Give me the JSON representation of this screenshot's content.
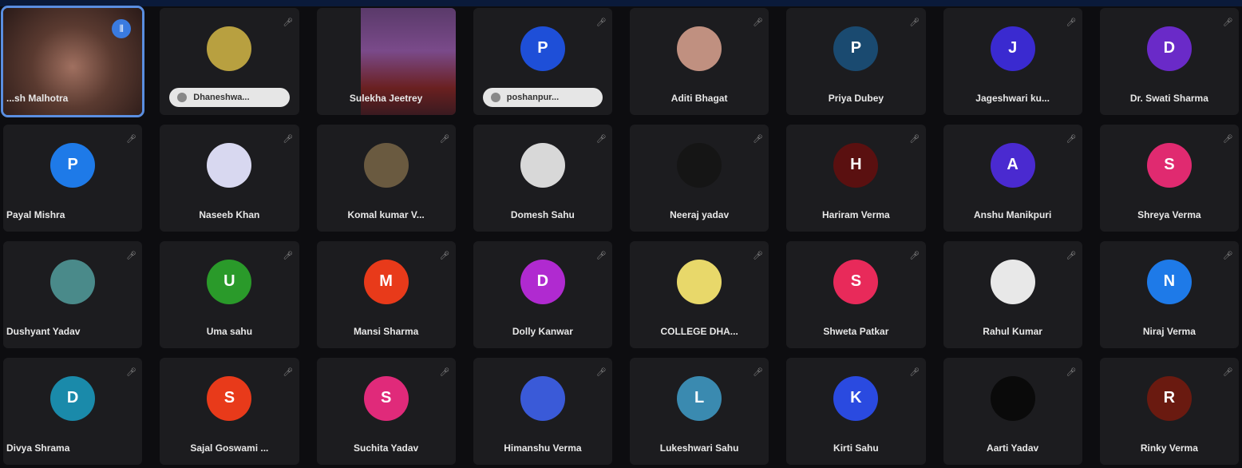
{
  "participants": [
    {
      "name": "...sh Malhotra",
      "video": "face",
      "speaking": true
    },
    {
      "name": "Dhaneshwa...",
      "avatar": "",
      "color": "#b8a040",
      "pill": true
    },
    {
      "name": "Sulekha Jeetrey",
      "video": "stage"
    },
    {
      "name": "poshanpur...",
      "avatar": "P",
      "color": "#1e4fd8",
      "pill": true
    },
    {
      "name": "Aditi Bhagat",
      "avatar": "",
      "color": "#c09080"
    },
    {
      "name": "Priya Dubey",
      "avatar": "P",
      "color": "#1a4a70"
    },
    {
      "name": "Jageshwari ku...",
      "avatar": "J",
      "color": "#3a2ad0"
    },
    {
      "name": "Dr. Swati Sharma",
      "avatar": "D",
      "color": "#6a2ac8"
    },
    {
      "name": "Payal Mishra",
      "avatar": "P",
      "color": "#1e7ae8"
    },
    {
      "name": "Naseeb Khan",
      "avatar": "",
      "color": "#d8d8f0"
    },
    {
      "name": "Komal kumar V...",
      "avatar": "",
      "color": "#6a5a40"
    },
    {
      "name": "Domesh Sahu",
      "avatar": "",
      "color": "#d8d8d8"
    },
    {
      "name": "Neeraj yadav",
      "avatar": "",
      "color": "#151515"
    },
    {
      "name": "Hariram Verma",
      "avatar": "H",
      "color": "#5a1010"
    },
    {
      "name": "Anshu Manikpuri",
      "avatar": "A",
      "color": "#4a2ad0"
    },
    {
      "name": "Shreya Verma",
      "avatar": "S",
      "color": "#e02a70"
    },
    {
      "name": "Dushyant Yadav",
      "avatar": "",
      "color": "#4a8a8a"
    },
    {
      "name": "Uma sahu",
      "avatar": "U",
      "color": "#2a9a2a"
    },
    {
      "name": "Mansi Sharma",
      "avatar": "M",
      "color": "#e83a1a"
    },
    {
      "name": "Dolly Kanwar",
      "avatar": "D",
      "color": "#b02ad0"
    },
    {
      "name": "COLLEGE DHA...",
      "avatar": "",
      "color": "#e8d86a"
    },
    {
      "name": "Shweta Patkar",
      "avatar": "S",
      "color": "#e82a5a"
    },
    {
      "name": "Rahul Kumar",
      "avatar": "",
      "color": "#e8e8e8"
    },
    {
      "name": "Niraj Verma",
      "avatar": "N",
      "color": "#1e7ae8"
    },
    {
      "name": "Divya Shrama",
      "avatar": "D",
      "color": "#1a8aaa"
    },
    {
      "name": "Sajal Goswami ...",
      "avatar": "S",
      "color": "#e83a1a"
    },
    {
      "name": "Suchita Yadav",
      "avatar": "S",
      "color": "#e02a7a"
    },
    {
      "name": "Himanshu Verma",
      "avatar": "",
      "color": "#3a5ad8"
    },
    {
      "name": "Lukeshwari Sahu",
      "avatar": "L",
      "color": "#3a8ab0"
    },
    {
      "name": "Kirti Sahu",
      "avatar": "K",
      "color": "#2a4ae0"
    },
    {
      "name": "Aarti Yadav",
      "avatar": "",
      "color": "#0a0a0a"
    },
    {
      "name": "Rinky Verma",
      "avatar": "R",
      "color": "#6a1a10"
    }
  ],
  "icons": {
    "mic": "mic-off-icon",
    "speaking": "audio-wave-icon"
  }
}
